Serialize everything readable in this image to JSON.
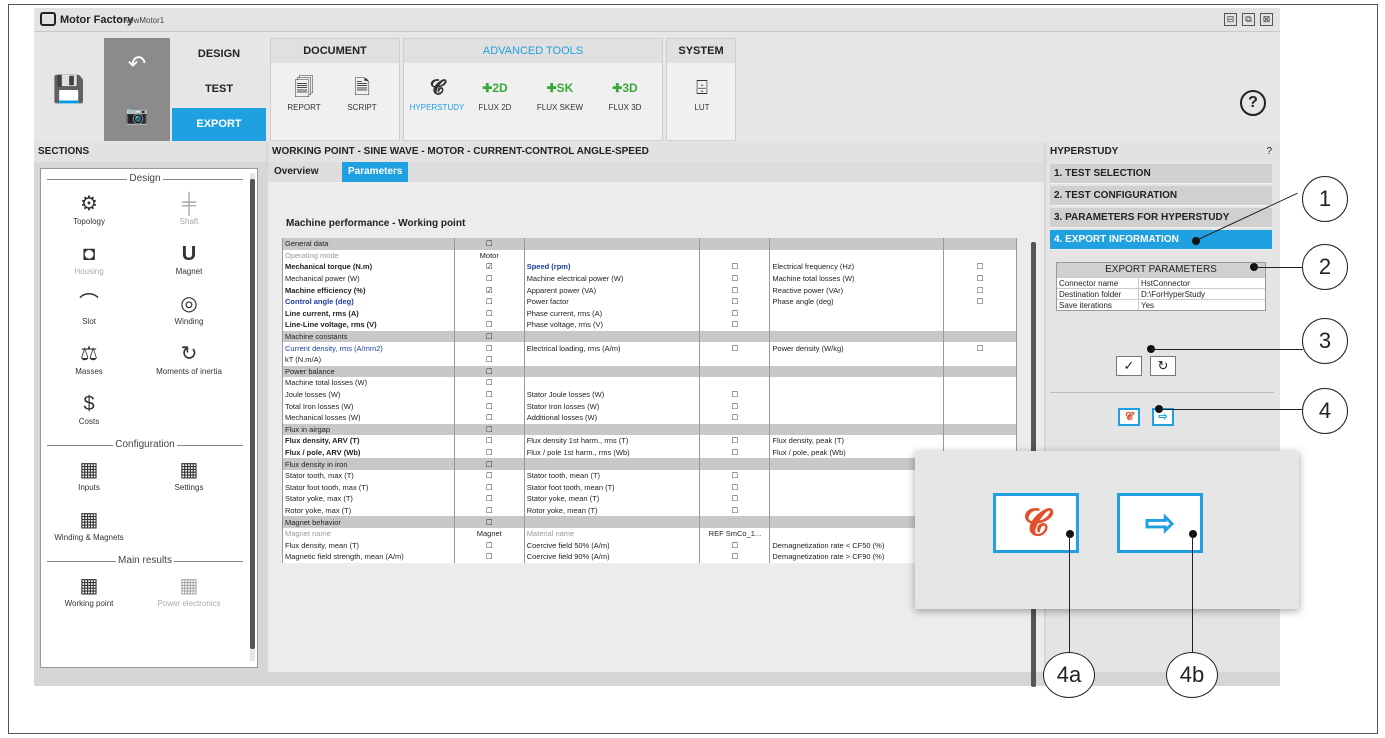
{
  "app": {
    "name": "Motor Factory",
    "file": "* NewMotor1"
  },
  "window_buttons": [
    "⊟",
    "⧉",
    "⊠"
  ],
  "nav": {
    "design": "DESIGN",
    "test": "TEST",
    "export": "EXPORT"
  },
  "ribbon": {
    "document": {
      "title": "DOCUMENT",
      "tools": [
        {
          "label": "REPORT",
          "icon": "report-icon"
        },
        {
          "label": "SCRIPT",
          "icon": "script-icon"
        }
      ]
    },
    "advanced": {
      "title": "ADVANCED TOOLS",
      "tools": [
        {
          "label": "HYPERSTUDY",
          "icon": "hyperstudy-icon"
        },
        {
          "label": "FLUX 2D",
          "icon": "flux-2d-icon"
        },
        {
          "label": "FLUX SKEW",
          "icon": "flux-skew-icon"
        },
        {
          "label": "FLUX 3D",
          "icon": "flux-3d-icon"
        }
      ]
    },
    "system": {
      "title": "SYSTEM",
      "tools": [
        {
          "label": "LUT",
          "icon": "lut-icon"
        }
      ]
    },
    "help": "?"
  },
  "sections": {
    "title": "SECTIONS",
    "design_label": "Design",
    "design_items": [
      {
        "label": "Topology"
      },
      {
        "label": "Shaft"
      },
      {
        "label": "Housing"
      },
      {
        "label": "Magnet"
      },
      {
        "label": "Slot"
      },
      {
        "label": "Winding"
      },
      {
        "label": "Masses"
      },
      {
        "label": "Moments of inertia"
      },
      {
        "label": "Costs"
      }
    ],
    "config_label": "Configuration",
    "config_items": [
      {
        "label": "Inputs"
      },
      {
        "label": "Settings"
      },
      {
        "label": "Winding & Magnets"
      }
    ],
    "results_label": "Main results",
    "results_items": [
      {
        "label": "Working point"
      },
      {
        "label": "Power electronics"
      }
    ]
  },
  "center": {
    "title": "WORKING POINT - SINE WAVE - MOTOR - CURRENT-CONTROL ANGLE-SPEED",
    "tabs": [
      "Overview",
      "Parameters"
    ],
    "section_title": "Machine performance - Working point",
    "table_rows": [
      {
        "sec": true,
        "c1": "General data",
        "k1": "☐"
      },
      {
        "c1": "Operating mode",
        "s1": "gr",
        "k1": "Motor"
      },
      {
        "c1": "Mechanical torque (N.m)",
        "s1": "b",
        "k1": "☑",
        "c2": "Speed (rpm)",
        "s2": "b bl",
        "k2": "☐",
        "c3": "Electrical frequency (Hz)",
        "k3": "☐"
      },
      {
        "c1": "Mechanical power (W)",
        "k1": "☐",
        "c2": "Machine electrical power (W)",
        "k2": "☐",
        "c3": "Machine total losses (W)",
        "k3": "☐"
      },
      {
        "c1": "Machine efficiency (%)",
        "s1": "b",
        "k1": "☑",
        "c2": "Apparent power (VA)",
        "k2": "☐",
        "c3": "Reactive power (VAr)",
        "k3": "☐"
      },
      {
        "c1": "Control angle (deg)",
        "s1": "b bl",
        "k1": "☐",
        "c2": "Power factor",
        "k2": "☐",
        "c3": "Phase angle (deg)",
        "k3": "☐"
      },
      {
        "c1": "Line current, rms (A)",
        "s1": "b",
        "k1": "☐",
        "c2": "Phase current, rms (A)",
        "k2": "☐"
      },
      {
        "c1": "Line-Line voltage, rms (V)",
        "s1": "b",
        "k1": "☐",
        "c2": "Phase voltage, rms (V)",
        "k2": "☐"
      },
      {
        "sec": true,
        "c1": "Machine constants",
        "k1": "☐"
      },
      {
        "c1": "Current density, rms (A/mm2)",
        "s1": "bl",
        "k1": "☐",
        "c2": "Electrical loading, rms (A/m)",
        "k2": "☐",
        "c3": "Power density (W/kg)",
        "k3": "☐"
      },
      {
        "c1": "kT (N.m/A)",
        "k1": "☐"
      },
      {
        "sec": true,
        "c1": "Power balance",
        "k1": "☐"
      },
      {
        "c1": "Machine total losses (W)",
        "k1": "☐"
      },
      {
        "c1": "Joule losses (W)",
        "k1": "☐",
        "c2": "Stator Joule losses (W)",
        "k2": "☐"
      },
      {
        "c1": "Total Iron losses (W)",
        "k1": "☐",
        "c2": "Stator Iron losses (W)",
        "k2": "☐"
      },
      {
        "c1": "Mechanical losses (W)",
        "k1": "☐",
        "c2": "Additional losses (W)",
        "k2": "☐"
      },
      {
        "sec": true,
        "c1": "Flux in airgap",
        "k1": "☐"
      },
      {
        "c1": "Flux density, ARV (T)",
        "s1": "b",
        "k1": "☐",
        "c2": "Flux density 1st harm., rms (T)",
        "k2": "☐",
        "c3": "Flux density, peak (T)"
      },
      {
        "c1": "Flux / pole, ARV (Wb)",
        "s1": "b",
        "k1": "☐",
        "c2": "Flux / pole 1st harm., rms (Wb)",
        "k2": "☐",
        "c3": "Flux / pole, peak (Wb)"
      },
      {
        "sec": true,
        "c1": "Flux density in iron",
        "k1": "☐"
      },
      {
        "c1": "Stator tooth, max (T)",
        "k1": "☐",
        "c2": "Stator tooth, mean (T)",
        "k2": "☐"
      },
      {
        "c1": "Stator foot tooth, max (T)",
        "k1": "☐",
        "c2": "Stator foot tooth, mean (T)",
        "k2": "☐"
      },
      {
        "c1": "Stator yoke, max (T)",
        "k1": "☐",
        "c2": "Stator yoke, mean (T)",
        "k2": "☐"
      },
      {
        "c1": "Rotor yoke, max (T)",
        "k1": "☐",
        "c2": "Rotor yoke, mean (T)",
        "k2": "☐"
      },
      {
        "sec": true,
        "c1": "Magnet behavior",
        "k1": "☐"
      },
      {
        "c1": "Magnet name",
        "s1": "gr",
        "k1": "Magnet",
        "c2": "Material name",
        "s2": "gr",
        "k2": "REF SmCo_1...",
        "c3": "",
        "k3": ""
      },
      {
        "c1": "Flux density, mean (T)",
        "k1": "☐",
        "c2": "Coercive field 50% (A/m)",
        "k2": "☐",
        "c3": "Demagnetization rate < CF50 (%)",
        "k3": "☐"
      },
      {
        "c1": "Magnetic field strength, mean (A/m)",
        "k1": "☐",
        "c2": "Coercive field 90% (A/m)",
        "k2": "☐",
        "c3": "Demagnetization rate > CF90 (%)",
        "k3": "☐"
      }
    ]
  },
  "hyperstudy": {
    "title": "HYPERSTUDY",
    "help": "?",
    "steps": [
      "1. TEST SELECTION",
      "2. TEST CONFIGURATION",
      "3. PARAMETERS FOR HYPERSTUDY",
      "4. EXPORT INFORMATION"
    ],
    "export": {
      "title": "EXPORT PARAMETERS",
      "rows": [
        {
          "k": "Connector name",
          "v": "HstConnector"
        },
        {
          "k": "Destination folder",
          "v": "D:\\ForHyperStudy"
        },
        {
          "k": "Save iterations",
          "v": "Yes"
        }
      ]
    },
    "validate": "✓",
    "reset": "↻"
  },
  "callouts": [
    "1",
    "2",
    "3",
    "4",
    "4a",
    "4b"
  ],
  "colors": {
    "accent": "#1fa0e0",
    "hyperstudy_icon": "#e0502a",
    "flux_icon": "#3aa83a"
  }
}
